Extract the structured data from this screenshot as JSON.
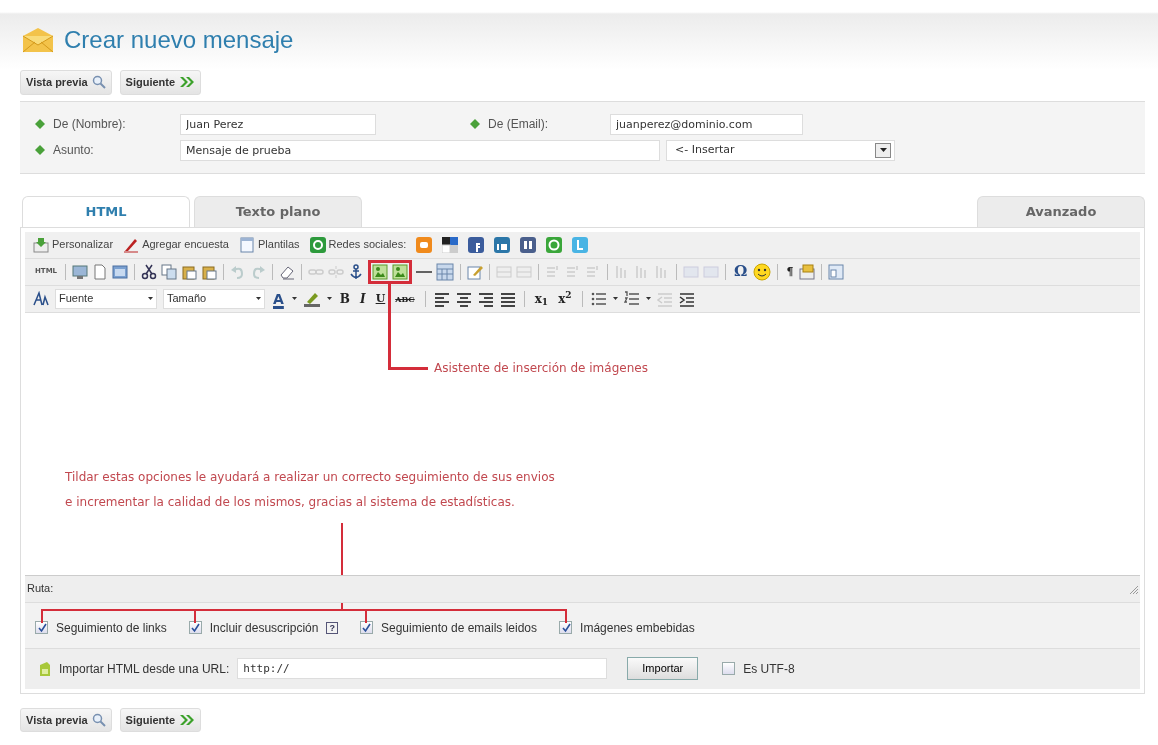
{
  "title": "Crear nuevo mensaje",
  "top_buttons": [
    {
      "label": "Vista previa",
      "kind": "preview"
    },
    {
      "label": "Siguiente",
      "kind": "next"
    }
  ],
  "fields": [
    {
      "label": "De (Nombre):",
      "value": "Juan Perez"
    },
    {
      "label": "De (Email):",
      "value": "juanperez@dominio.com"
    },
    {
      "label": "Asunto:",
      "value": "Mensaje de prueba"
    }
  ],
  "insert_select": {
    "value": "<- Insertar"
  },
  "tabs": [
    {
      "label": "HTML",
      "selected": true
    },
    {
      "label": "Texto plano",
      "selected": false
    },
    {
      "label": "Avanzado",
      "selected": false
    }
  ],
  "toolbar_links": [
    {
      "label": "Personalizar",
      "kind": "personalize"
    },
    {
      "label": "Agregar encuesta",
      "kind": "poll"
    },
    {
      "label": "Plantilas",
      "kind": "templates"
    },
    {
      "label": "Redes sociales:",
      "kind": "social"
    }
  ],
  "toolbar_glyphs": [
    "HTML",
    "Ω",
    "¶"
  ],
  "font_select": {
    "value": "Fuente"
  },
  "size_select": {
    "value": "Tamaño"
  },
  "format_glyphs": [
    "A",
    "B",
    "I",
    "U",
    "ABC",
    "x$_{1}$",
    "x$^{2}$"
  ],
  "annotations": {
    "image_wizard": "Asistente de inserción de imágenes",
    "tracking_note": [
      "Tildar estas opciones le ayudará a realizar un correcto seguimiento de sus envios",
      "e incrementar la calidad de los mismos, gracias al sistema de estadísticas."
    ]
  },
  "path_label": "Ruta:",
  "options": [
    {
      "label": "Seguimiento de links",
      "checked": true
    },
    {
      "label": "Incluir desuscripción",
      "checked": true,
      "help": "?"
    },
    {
      "label": "Seguimiento de emails leidos",
      "checked": true
    },
    {
      "label": "Imágenes embebidas",
      "checked": true
    }
  ],
  "import": {
    "label": "Importar HTML desde una URL:",
    "value": "http://",
    "button": "Importar",
    "utf8": {
      "label": "Es UTF-8",
      "checked": false
    }
  },
  "bottom_buttons": [
    {
      "label": "Vista previa",
      "kind": "preview"
    },
    {
      "label": "Siguiente",
      "kind": "next"
    }
  ]
}
